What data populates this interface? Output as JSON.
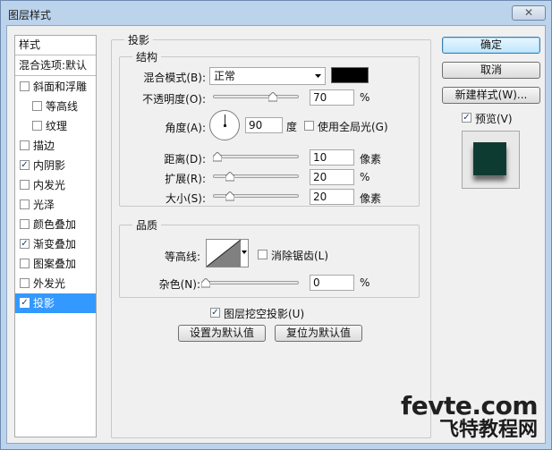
{
  "window": {
    "title": "图层样式",
    "close_label": "✕"
  },
  "left_list": {
    "header": "样式",
    "blend_options": "混合选项:默认",
    "items": [
      {
        "label": "斜面和浮雕",
        "checked": false,
        "sub": false,
        "selected": false
      },
      {
        "label": "等高线",
        "checked": false,
        "sub": true,
        "selected": false
      },
      {
        "label": "纹理",
        "checked": false,
        "sub": true,
        "selected": false
      },
      {
        "label": "描边",
        "checked": false,
        "sub": false,
        "selected": false
      },
      {
        "label": "内阴影",
        "checked": true,
        "sub": false,
        "selected": false
      },
      {
        "label": "内发光",
        "checked": false,
        "sub": false,
        "selected": false
      },
      {
        "label": "光泽",
        "checked": false,
        "sub": false,
        "selected": false
      },
      {
        "label": "颜色叠加",
        "checked": false,
        "sub": false,
        "selected": false
      },
      {
        "label": "渐变叠加",
        "checked": true,
        "sub": false,
        "selected": false
      },
      {
        "label": "图案叠加",
        "checked": false,
        "sub": false,
        "selected": false
      },
      {
        "label": "外发光",
        "checked": false,
        "sub": false,
        "selected": false
      },
      {
        "label": "投影",
        "checked": true,
        "sub": false,
        "selected": true
      }
    ]
  },
  "drop_shadow": {
    "title": "投影",
    "structure": {
      "title": "结构",
      "blend_mode_label": "混合模式(B):",
      "blend_mode_value": "正常",
      "shadow_color": "#000000",
      "opacity_label": "不透明度(O):",
      "opacity_value": "70",
      "opacity_unit": "%",
      "opacity_level": 0.7,
      "angle_label": "角度(A):",
      "angle_value": "90",
      "angle_unit": "度",
      "global_light_label": "使用全局光(G)",
      "global_light_checked": false,
      "distance_label": "距离(D):",
      "distance_value": "10",
      "distance_unit": "像素",
      "distance_level": 0.05,
      "spread_label": "扩展(R):",
      "spread_value": "20",
      "spread_unit": "%",
      "spread_level": 0.2,
      "size_label": "大小(S):",
      "size_value": "20",
      "size_unit": "像素",
      "size_level": 0.2
    },
    "quality": {
      "title": "品质",
      "contour_label": "等高线:",
      "anti_alias_label": "消除锯齿(L)",
      "anti_alias_checked": false,
      "noise_label": "杂色(N):",
      "noise_value": "0",
      "noise_unit": "%",
      "noise_level": 0.0
    },
    "knockout_label": "图层挖空投影(U)",
    "knockout_checked": true,
    "make_default_label": "设置为默认值",
    "reset_default_label": "复位为默认值"
  },
  "right_panel": {
    "ok_label": "确定",
    "cancel_label": "取消",
    "new_style_label": "新建样式(W)...",
    "preview_label": "预览(V)",
    "preview_checked": true,
    "preview_fill": "#0d3a31"
  },
  "watermark": {
    "line1": "fevte.com",
    "line2": "飞特教程网"
  }
}
